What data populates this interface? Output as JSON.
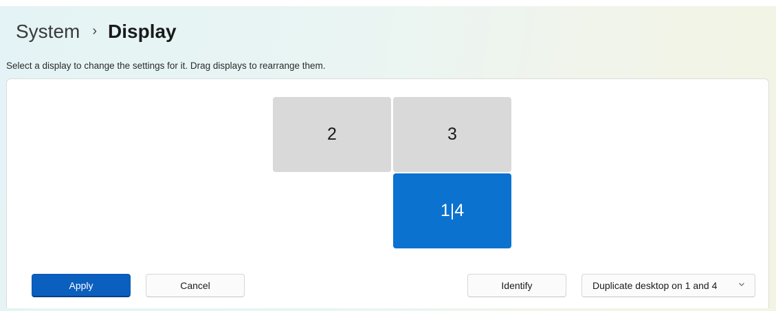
{
  "breadcrumb": {
    "parent": "System",
    "separator": "›",
    "current": "Display"
  },
  "instructions": "Select a display to change the settings for it. Drag displays to rearrange them.",
  "monitors": [
    {
      "label": "2",
      "selected": false
    },
    {
      "label": "3",
      "selected": false
    },
    {
      "label": "1|4",
      "selected": true
    }
  ],
  "actions": {
    "apply": "Apply",
    "cancel": "Cancel",
    "identify": "Identify"
  },
  "multi_display": {
    "selected_option": "Duplicate desktop on 1 and 4",
    "icon": "chevron-down-icon"
  },
  "colors": {
    "accent": "#0b5fbf",
    "selected_monitor": "#0b72d0",
    "unselected_monitor": "#d9d9d9"
  }
}
